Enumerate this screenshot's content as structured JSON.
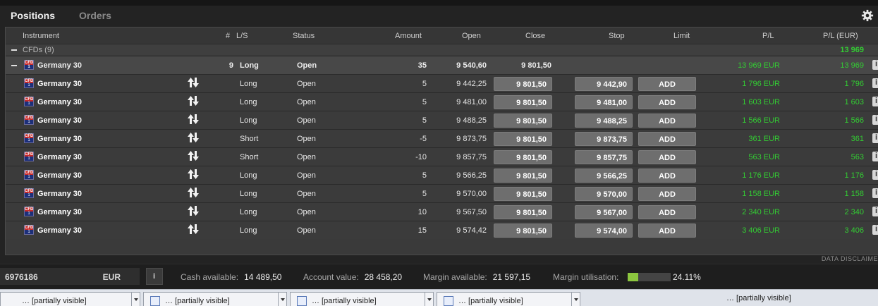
{
  "tabs": [
    {
      "label": "Positions",
      "active": true
    },
    {
      "label": "Orders",
      "active": false
    }
  ],
  "columns": {
    "instrument": "Instrument",
    "count": "#",
    "ls": "L/S",
    "status": "Status",
    "amount": "Amount",
    "open": "Open",
    "close": "Close",
    "stop": "Stop",
    "limit": "Limit",
    "pl": "P/L",
    "pl_eur": "P/L (EUR)"
  },
  "group": {
    "label": "CFDs (9)",
    "pl_eur": "13 969"
  },
  "summary": {
    "instrument": "Germany 30",
    "count": "9",
    "ls": "Long",
    "status": "Open",
    "amount": "35",
    "open": "9 540,60",
    "close": "9 801,50",
    "pl": "13 969 EUR",
    "pl_eur": "13 969"
  },
  "positions": [
    {
      "instrument": "Germany 30",
      "ls": "Long",
      "status": "Open",
      "amount": "5",
      "open": "9 442,25",
      "close": "9 801,50",
      "stop": "9 442,90",
      "limit": "ADD",
      "pl": "1 796 EUR",
      "pl_eur": "1 796"
    },
    {
      "instrument": "Germany 30",
      "ls": "Long",
      "status": "Open",
      "amount": "5",
      "open": "9 481,00",
      "close": "9 801,50",
      "stop": "9 481,00",
      "limit": "ADD",
      "pl": "1 603 EUR",
      "pl_eur": "1 603"
    },
    {
      "instrument": "Germany 30",
      "ls": "Long",
      "status": "Open",
      "amount": "5",
      "open": "9 488,25",
      "close": "9 801,50",
      "stop": "9 488,25",
      "limit": "ADD",
      "pl": "1 566 EUR",
      "pl_eur": "1 566"
    },
    {
      "instrument": "Germany 30",
      "ls": "Short",
      "status": "Open",
      "amount": "-5",
      "open": "9 873,75",
      "close": "9 801,50",
      "stop": "9 873,75",
      "limit": "ADD",
      "pl": "361 EUR",
      "pl_eur": "361"
    },
    {
      "instrument": "Germany 30",
      "ls": "Short",
      "status": "Open",
      "amount": "-10",
      "open": "9 857,75",
      "close": "9 801,50",
      "stop": "9 857,75",
      "limit": "ADD",
      "pl": "563 EUR",
      "pl_eur": "563"
    },
    {
      "instrument": "Germany 30",
      "ls": "Long",
      "status": "Open",
      "amount": "5",
      "open": "9 566,25",
      "close": "9 801,50",
      "stop": "9 566,25",
      "limit": "ADD",
      "pl": "1 176 EUR",
      "pl_eur": "1 176"
    },
    {
      "instrument": "Germany 30",
      "ls": "Long",
      "status": "Open",
      "amount": "5",
      "open": "9 570,00",
      "close": "9 801,50",
      "stop": "9 570,00",
      "limit": "ADD",
      "pl": "1 158 EUR",
      "pl_eur": "1 158"
    },
    {
      "instrument": "Germany 30",
      "ls": "Long",
      "status": "Open",
      "amount": "10",
      "open": "9 567,50",
      "close": "9 801,50",
      "stop": "9 567,00",
      "limit": "ADD",
      "pl": "2 340 EUR",
      "pl_eur": "2 340"
    },
    {
      "instrument": "Germany 30",
      "ls": "Long",
      "status": "Open",
      "amount": "15",
      "open": "9 574,42",
      "close": "9 801,50",
      "stop": "9 574,00",
      "limit": "ADD",
      "pl": "3 406 EUR",
      "pl_eur": "3 406"
    }
  ],
  "icon_labels": {
    "cfd_top": "CFD",
    "cfd_bottom": "1",
    "info": "i"
  },
  "disclaimer": "DATA DISCLAIME",
  "footer": {
    "account": "6976186",
    "currency": "EUR",
    "info_button": "i",
    "cash_label": "Cash available:",
    "cash_value": "14 489,50",
    "account_value_label": "Account value:",
    "account_value": "28 458,20",
    "margin_available_label": "Margin available:",
    "margin_available": "21 597,15",
    "margin_util_label": "Margin utilisation:",
    "margin_util_value": "24.11%",
    "margin_util_fraction": 0.2411
  },
  "taskbar": {
    "items": [
      "… [partially visible]",
      "… [partially visible]",
      "… [partially visible]",
      "… [partially visible]"
    ],
    "tray": "… [partially visible]"
  },
  "colors": {
    "profit": "#33cc33",
    "margin_bar": "#8cc63f"
  }
}
